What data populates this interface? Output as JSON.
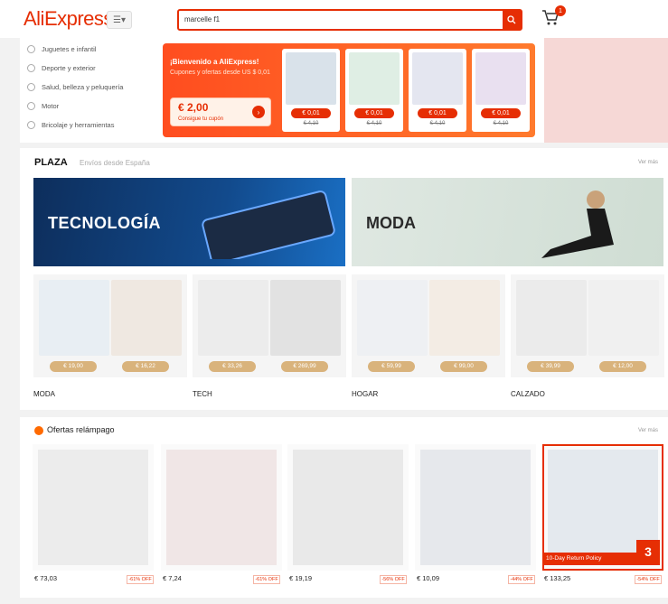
{
  "header": {
    "logo": "AliExpress",
    "category_label": "☰▾",
    "search_value": "marcelle f1",
    "cart_count": "1"
  },
  "sidebar": {
    "items": [
      {
        "label": "Juguetes e infantil",
        "icon": "toy-icon"
      },
      {
        "label": "Deporte y exterior",
        "icon": "sport-icon"
      },
      {
        "label": "Salud, belleza y peluquería",
        "icon": "beauty-icon"
      },
      {
        "label": "Motor",
        "icon": "car-icon"
      },
      {
        "label": "Bricolaje y herramientas",
        "icon": "tools-icon"
      }
    ]
  },
  "promo": {
    "title": "¡Bienvenido a AliExpress!",
    "subtitle": "Cupones y ofertas desde US $ 0,01",
    "coupon_price": "€ 2,00",
    "coupon_sub": "Consigue tu cupón",
    "coupon_go": "›",
    "deals": [
      {
        "price": "€ 0,01",
        "old": "€ 4,10"
      },
      {
        "price": "€ 0,01",
        "old": "€ 4,10"
      },
      {
        "price": "€ 0,01",
        "old": "€ 4,10"
      },
      {
        "price": "€ 0,01",
        "old": "€ 4,10"
      }
    ]
  },
  "plaza": {
    "title": "PLAZA",
    "subtitle": "Envíos desde España",
    "see_more": "Ver más",
    "banners": [
      {
        "label": "TECNOLOGÍA"
      },
      {
        "label": "MODA"
      }
    ],
    "categories": [
      {
        "label": "MODA",
        "prices": [
          "€ 19,00",
          "€ 16,22"
        ]
      },
      {
        "label": "TECH",
        "prices": [
          "€ 33,26",
          "€ 269,99"
        ]
      },
      {
        "label": "HOGAR",
        "prices": [
          "€ 59,99",
          "€ 99,00"
        ]
      },
      {
        "label": "CALZADO",
        "prices": [
          "€ 39,99",
          "€ 12,00"
        ]
      }
    ]
  },
  "flash": {
    "title": "Ofertas relámpago",
    "see_more": "Ver más",
    "items": [
      {
        "price": "€ 73,03",
        "off": "-61% OFF"
      },
      {
        "price": "€ 7,24",
        "off": "-61% OFF"
      },
      {
        "price": "€ 19,19",
        "off": "-56% OFF"
      },
      {
        "price": "€ 10,09",
        "off": "-44% OFF"
      },
      {
        "price": "€ 133,25",
        "off": "-54% OFF"
      }
    ],
    "tag": "10-Day Return Policy",
    "badge": "3"
  },
  "colors": {
    "brand": "#e62e04",
    "tech_banner": "#124a8c",
    "moda_banner": "#cfddd3",
    "price_pill": "#d9b37c"
  }
}
